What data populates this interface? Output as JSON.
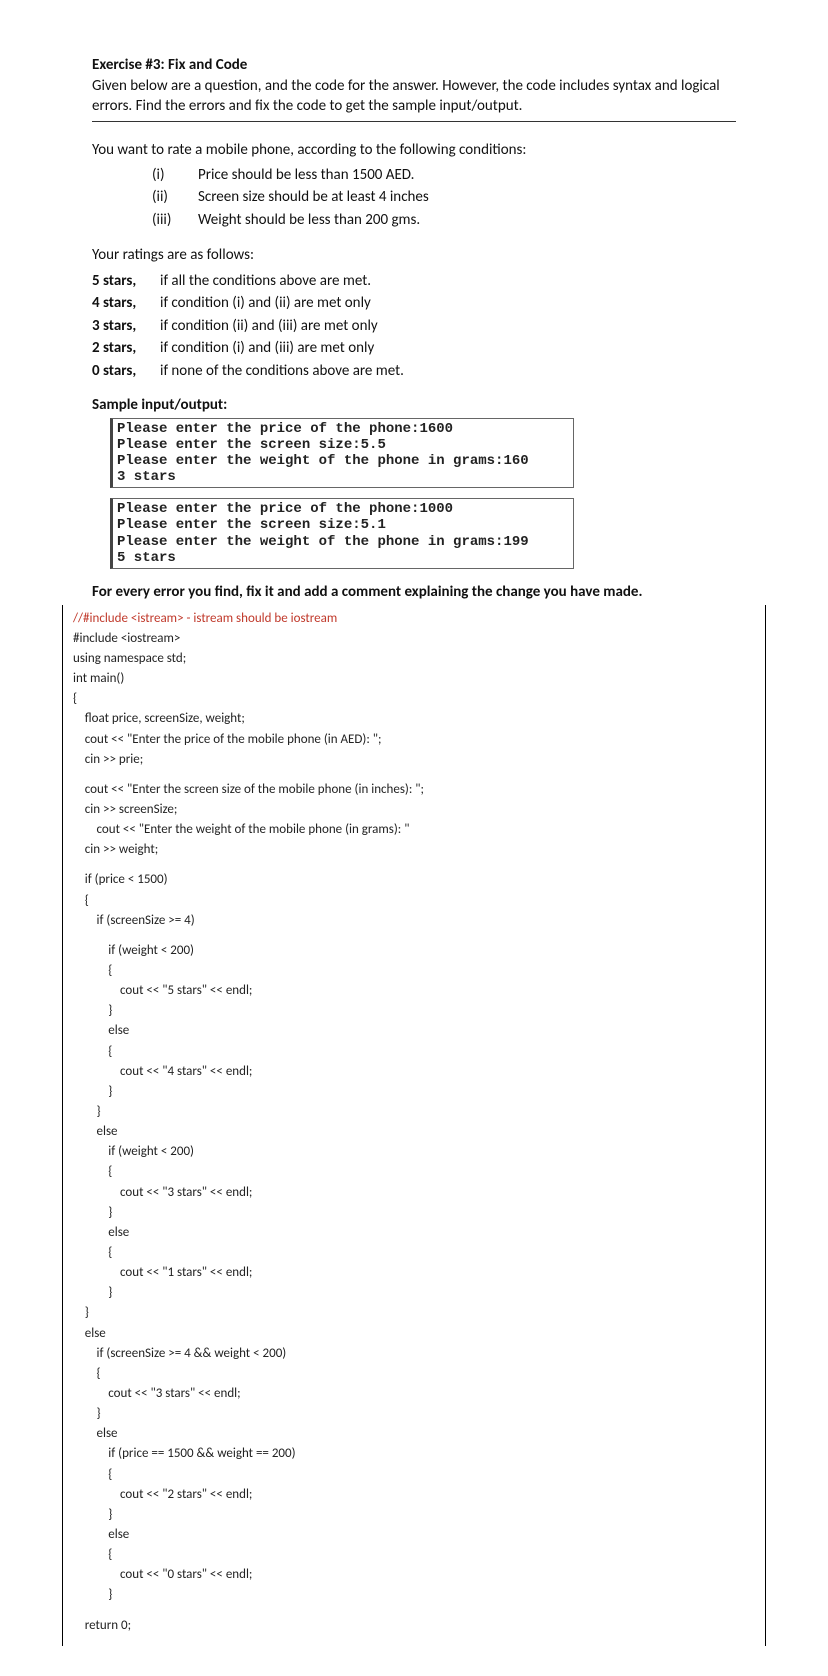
{
  "title": "Exercise #3: Fix and Code",
  "intro": "Given below are a question, and the code for the answer. However, the code includes syntax and logical errors. Find the errors and fix the code to get the sample input/output.",
  "question_intro": "You want to rate a mobile phone, according to the following conditions:",
  "conditions": [
    {
      "num": "(i)",
      "text": "Price should be less than 1500 AED."
    },
    {
      "num": "(ii)",
      "text": "Screen size should be at least 4 inches"
    },
    {
      "num": "(iii)",
      "text": "Weight should be less than 200 gms."
    }
  ],
  "ratings_intro": "Your ratings are as follows:",
  "ratings": [
    {
      "lbl": "5 stars,",
      "text": "if all the conditions above are met."
    },
    {
      "lbl": "4 stars,",
      "text": "if condition (i) and (ii) are met only"
    },
    {
      "lbl": "3 stars,",
      "text": "if condition (ii) and (iii) are met only"
    },
    {
      "lbl": "2 stars,",
      "text": "if condition (i) and (iii) are met only"
    },
    {
      "lbl": "0 stars,",
      "text": "if none of the conditions above are met."
    }
  ],
  "sample_head": "Sample input/output:",
  "console1": "Please enter the price of the phone:1600\nPlease enter the screen size:5.5\nPlease enter the weight of the phone in grams:160\n3 stars",
  "console2": "Please enter the price of the phone:1000\nPlease enter the screen size:5.1\nPlease enter the weight of the phone in grams:199\n5 stars",
  "instruction": "For every error you find, fix it and add a comment explaining the change you have made.",
  "code": {
    "c1": "//#include <istream> - istream should be iostream",
    "l1": "#include <iostream>",
    "l2": "using namespace std;",
    "l3": "int main()",
    "l4": "{",
    "l5": "    float price, screenSize, weight;",
    "l6": "    cout << \"Enter the price of the mobile phone (in AED): \";",
    "l7": "    cin >> prie;",
    "l8": "    cout << \"Enter the screen size of the mobile phone (in inches): \";",
    "l9": "    cin >> screenSize;",
    "l10": "        cout << \"Enter the weight of the mobile phone (in grams): \"",
    "l11": "    cin >> weight;",
    "l12": "    if (price < 1500)",
    "l13": "    {",
    "l14": "        if (screenSize >= 4)",
    "l15": "            if (weight < 200)",
    "l16": "            {",
    "l17": "                cout << \"5 stars\" << endl;",
    "l18": "            }",
    "l19": "            else",
    "l20": "            {",
    "l21": "                cout << \"4 stars\" << endl;",
    "l22": "            }",
    "l23": "        }",
    "l24": "        else",
    "l25": "            if (weight < 200)",
    "l26": "            {",
    "l27": "                cout << \"3 stars\" << endl;",
    "l28": "            }",
    "l29": "            else",
    "l30": "            {",
    "l31": "                cout << \"1 stars\" << endl;",
    "l32": "            }",
    "l33": "    }",
    "l34": "    else",
    "l35": "        if (screenSize >= 4 && weight < 200)",
    "l36": "        {",
    "l37": "            cout << \"3 stars\" << endl;",
    "l38": "        }",
    "l39": "        else",
    "l40": "            if (price == 1500 && weight == 200)",
    "l41": "            {",
    "l42": "                cout << \"2 stars\" << endl;",
    "l43": "            }",
    "l44": "            else",
    "l45": "            {",
    "l46": "                cout << \"0 stars\" << endl;",
    "l47": "            }",
    "l48": "    return 0;"
  }
}
